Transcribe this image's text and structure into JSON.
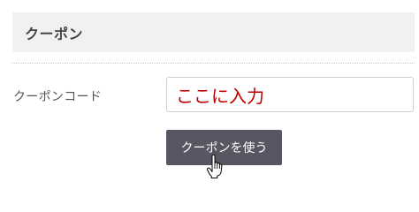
{
  "coupon": {
    "section_title": "クーポン",
    "field_label": "クーポンコード",
    "input_value": "ここに入力",
    "apply_button_label": "クーポンを使う"
  },
  "cursor": {
    "icon": "hand-pointer-icon"
  },
  "colors": {
    "header_bg": "#f1f1f1",
    "input_text": "#c00000",
    "button_bg": "#575663",
    "button_text": "#ffffff"
  }
}
